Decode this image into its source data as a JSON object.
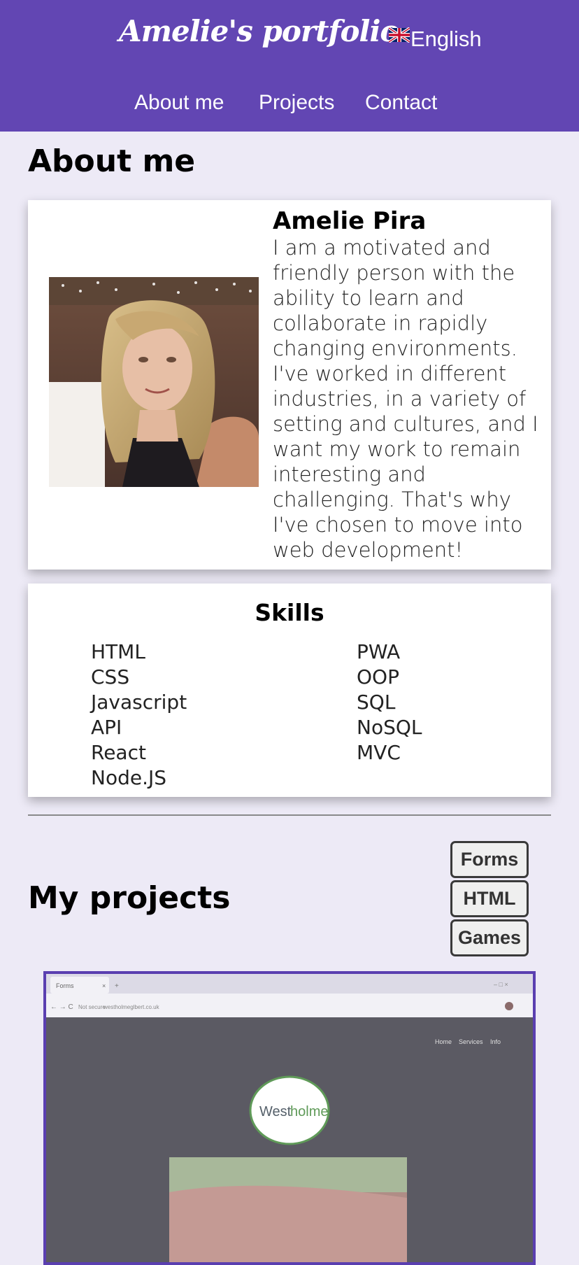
{
  "header": {
    "site_title": "Amelie's portfolio",
    "language": {
      "label": "English",
      "icon": "uk-flag-icon"
    },
    "nav": [
      {
        "label": "About me"
      },
      {
        "label": "Projects"
      },
      {
        "label": "Contact"
      }
    ]
  },
  "about": {
    "heading": "About me",
    "name": "Amelie Pira",
    "bio": "I am a motivated and friendly person with the ability to learn and collaborate in rapidly changing environments. I've worked in different industries, in a variety of setting and cultures, and I want my work to remain interesting and challenging. That's why I've chosen to move into web development!"
  },
  "skills": {
    "heading": "Skills",
    "column1": [
      "HTML",
      "CSS",
      "Javascript",
      "API",
      "React",
      "Node.JS"
    ],
    "column2": [
      "PWA",
      "OOP",
      "SQL",
      "NoSQL",
      "MVC"
    ]
  },
  "projects": {
    "heading": "My projects",
    "filters": [
      {
        "label": "Forms"
      },
      {
        "label": "HTML"
      },
      {
        "label": "Games"
      }
    ],
    "preview": {
      "tab_title": "Forms",
      "url": "westholmeglbert.co.uk",
      "security": "Not secure",
      "logo_text_1": "West",
      "logo_text_2": "holme",
      "menu": [
        "Home",
        "Services",
        "Info"
      ]
    }
  },
  "colors": {
    "header_bg": "#6246b3",
    "page_bg": "#edeaf6",
    "frame_border": "#5a3fb0"
  }
}
